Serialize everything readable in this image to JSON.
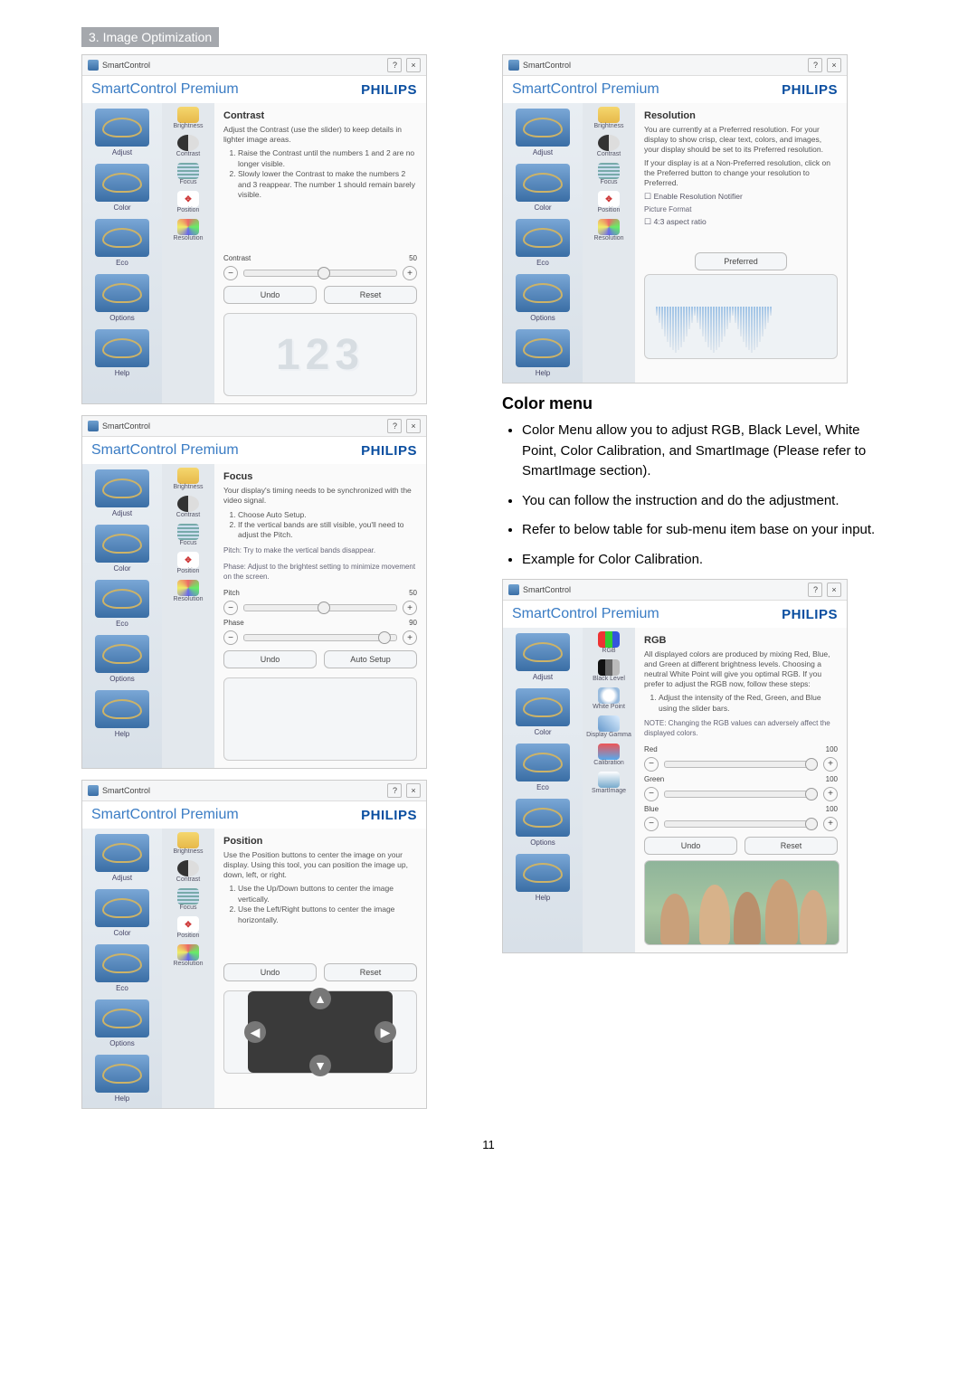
{
  "section_label": "3. Image Optimization",
  "page_number": "11",
  "common": {
    "titlebar": "SmartControl",
    "brand_title": "SmartControl Premium",
    "brand_logo": "PHILIPS",
    "sidebar": [
      "Adjust",
      "Color",
      "Eco",
      "Options",
      "Help"
    ],
    "undo": "Undo",
    "reset": "Reset",
    "preferred": "Preferred",
    "auto_setup": "Auto Setup"
  },
  "panel_contrast": {
    "heading": "Contrast",
    "lead": "Adjust the Contrast (use the slider) to keep details in lighter image areas.",
    "steps": [
      "Raise the Contrast until the numbers 1 and 2 are no longer visible.",
      "Slowly lower the Contrast to make the numbers 2 and 3 reappear. The number 1 should remain barely visible."
    ],
    "sub": [
      "Brightness",
      "Contrast",
      "Focus",
      "Position",
      "Resolution"
    ],
    "slider_label": "Contrast",
    "slider_value": "50"
  },
  "panel_focus": {
    "heading": "Focus",
    "lead": "Your display's timing needs to be synchronized with the video signal.",
    "steps": [
      "Choose Auto Setup.",
      "If the vertical bands are still visible, you'll need to adjust the Pitch."
    ],
    "note_pitch": "Pitch: Try to make the vertical bands disappear.",
    "note_phase": "Phase: Adjust to the brightest setting to minimize movement on the screen.",
    "sub": [
      "Brightness",
      "Contrast",
      "Focus",
      "Position",
      "Resolution"
    ],
    "sliders": [
      {
        "label": "Pitch",
        "value": "50"
      },
      {
        "label": "Phase",
        "value": "90"
      }
    ]
  },
  "panel_position": {
    "heading": "Position",
    "lead": "Use the Position buttons to center the image on your display. Using this tool, you can position the image up, down, left, or right.",
    "steps": [
      "Use the Up/Down buttons to center the image vertically.",
      "Use the Left/Right buttons to center the image horizontally."
    ],
    "sub": [
      "Brightness",
      "Contrast",
      "Focus",
      "Position",
      "Resolution"
    ]
  },
  "panel_resolution": {
    "heading": "Resolution",
    "lead": "You are currently at a Preferred resolution. For your display to show crisp, clear text, colors, and images, your display should be set to its Preferred resolution.",
    "lead2": "If your display is at a Non-Preferred resolution, click on the Preferred button to change your resolution to Preferred.",
    "checkbox1": "Enable Resolution Notifier",
    "format_label": "Picture Format",
    "checkbox2": "4:3 aspect ratio",
    "sub": [
      "Brightness",
      "Contrast",
      "Focus",
      "Position",
      "Resolution"
    ]
  },
  "color_menu": {
    "heading": "Color menu",
    "bullets": [
      "Color Menu allow you to adjust RGB, Black Level, White Point, Color Calibration, and SmartImage (Please refer to SmartImage section).",
      "You can follow the instruction and do the adjustment.",
      "Refer to below table for sub-menu item base on your input.",
      "Example for Color Calibration."
    ]
  },
  "panel_rgb": {
    "heading": "RGB",
    "lead": "All displayed colors are produced by mixing Red, Blue, and Green at different brightness levels. Choosing a neutral White Point will give you optimal RGB. If you prefer to adjust the RGB now, follow these steps:",
    "steps": [
      "Adjust the intensity of the Red, Green, and Blue using the slider bars."
    ],
    "note": "NOTE: Changing the RGB values can adversely affect the displayed colors.",
    "sub": [
      "RGB",
      "Black Level",
      "White Point",
      "Display Gamma",
      "Calibration",
      "SmartImage"
    ],
    "sliders": [
      {
        "label": "Red",
        "value": "100"
      },
      {
        "label": "Green",
        "value": "100"
      },
      {
        "label": "Blue",
        "value": "100"
      }
    ]
  }
}
